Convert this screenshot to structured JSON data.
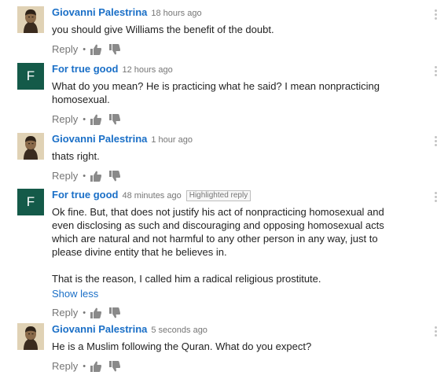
{
  "comments": [
    {
      "author": "Giovanni Palestrina",
      "time": "18 hours ago",
      "avatar": "portrait-avatar",
      "text": "you should give Williams the benefit of the doubt.",
      "reply_label": "Reply",
      "separator": "•"
    },
    {
      "author": "For true good",
      "time": "12 hours ago",
      "avatar_letter": "F",
      "avatar_color": "#145a49",
      "text": "What do you mean? He is practicing what he said? I mean nonpracticing homosexual.",
      "reply_label": "Reply",
      "separator": "•"
    },
    {
      "author": "Giovanni Palestrina",
      "time": "1 hour ago",
      "avatar": "portrait-avatar",
      "text": "thats right.",
      "reply_label": "Reply",
      "separator": "•"
    },
    {
      "author": "For true good",
      "time": "48 minutes ago",
      "badge": "Highlighted reply",
      "avatar_letter": "F",
      "avatar_color": "#145a49",
      "text_p1": "Ok fine. But, that does not justify his act of nonpracticing homosexual and even disclosing as such and discouraging and opposing homosexual acts which are natural and not harmful to any other person in any way, just to please divine entity that he believes in.",
      "text_p2": "That is the reason, I called him a radical religious prostitute.",
      "show_less": "Show less",
      "reply_label": "Reply",
      "separator": "•"
    },
    {
      "author": "Giovanni Palestrina",
      "time": "5 seconds ago",
      "avatar": "portrait-avatar",
      "text": "He is a Muslim following the Quran. What do you expect?",
      "reply_label": "Reply",
      "separator": "•"
    }
  ],
  "colors": {
    "link": "#1a6fc7",
    "meta": "#767676",
    "avatar_bg": "#145a49"
  }
}
